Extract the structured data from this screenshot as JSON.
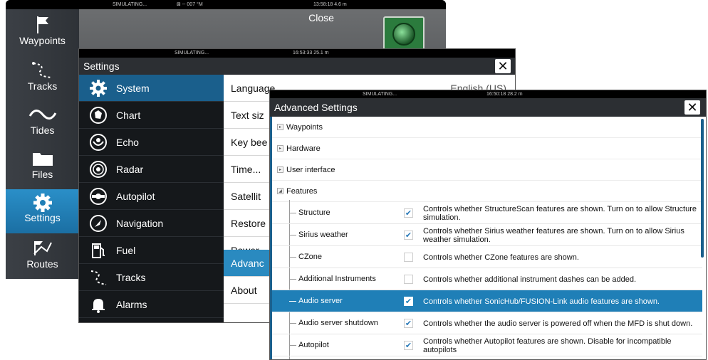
{
  "back_window": {
    "status": {
      "left": "SIMULATING...",
      "mid": "⊠ -- 007 °M",
      "right": "13:58:18 4.6 m"
    },
    "close_label": "Close",
    "home_items": [
      {
        "label": "Waypoints",
        "icon": "flag-icon"
      },
      {
        "label": "Tracks",
        "icon": "tracks-icon"
      },
      {
        "label": "Tides",
        "icon": "tide-wave-icon"
      },
      {
        "label": "Files",
        "icon": "folder-icon"
      },
      {
        "label": "Settings",
        "icon": "gear-icon",
        "active": true
      },
      {
        "label": "Routes",
        "icon": "routes-icon"
      }
    ]
  },
  "settings_window": {
    "status": {
      "left": "SIMULATING...",
      "right": "16:53:33 25.1 m"
    },
    "title": "Settings",
    "close": "✕",
    "categories": [
      {
        "label": "System",
        "icon": "gear-icon",
        "active": true
      },
      {
        "label": "Chart",
        "icon": "chart-icon"
      },
      {
        "label": "Echo",
        "icon": "echo-icon"
      },
      {
        "label": "Radar",
        "icon": "radar-icon"
      },
      {
        "label": "Autopilot",
        "icon": "autopilot-icon"
      },
      {
        "label": "Navigation",
        "icon": "navigation-icon"
      },
      {
        "label": "Fuel",
        "icon": "fuel-icon"
      },
      {
        "label": "Tracks",
        "icon": "tracks-icon"
      },
      {
        "label": "Alarms",
        "icon": "bell-icon"
      }
    ],
    "system_items": [
      {
        "label": "Language",
        "value": "English (US)"
      },
      {
        "label": "Text siz"
      },
      {
        "label": "Key bee"
      },
      {
        "label": "Time..."
      },
      {
        "label": "Satellit"
      },
      {
        "label": "Restore"
      },
      {
        "label": "Power"
      },
      {
        "label": "Advanc",
        "active": true
      },
      {
        "label": "About"
      }
    ]
  },
  "advanced_window": {
    "status": {
      "left": "SIMULATING...",
      "right": "16:50:18 28.2 m"
    },
    "title": "Advanced Settings",
    "close": "✕",
    "groups": [
      {
        "label": "Waypoints",
        "expander": "▸"
      },
      {
        "label": "Hardware",
        "expander": "▸"
      },
      {
        "label": "User interface",
        "expander": "▸"
      },
      {
        "label": "Features",
        "expander": "◢"
      }
    ],
    "features": [
      {
        "name": "Structure",
        "checked": true,
        "desc": "Controls whether StructureScan features are shown. Turn on to allow Structure simulation."
      },
      {
        "name": "Sirius weather",
        "checked": true,
        "desc": "Controls whether Sirius weather features are shown. Turn on to allow Sirius weather simulation."
      },
      {
        "name": "CZone",
        "checked": false,
        "desc": "Controls whether CZone features are shown."
      },
      {
        "name": "Additional Instruments",
        "checked": false,
        "desc": "Controls whether additional instrument dashes can be added."
      },
      {
        "name": "Audio server",
        "checked": true,
        "active": true,
        "desc": "Controls whether SonicHub/FUSION-Link audio features are shown."
      },
      {
        "name": "Audio server shutdown",
        "checked": true,
        "desc": "Controls whether the audio server is powered off when the MFD is shut down."
      },
      {
        "name": "Autopilot",
        "checked": true,
        "desc": "Controls whether Autopilot features are shown. Disable for incompatible autopilots"
      }
    ],
    "check_glyph": "✔",
    "accent": "#1f7fb7"
  }
}
